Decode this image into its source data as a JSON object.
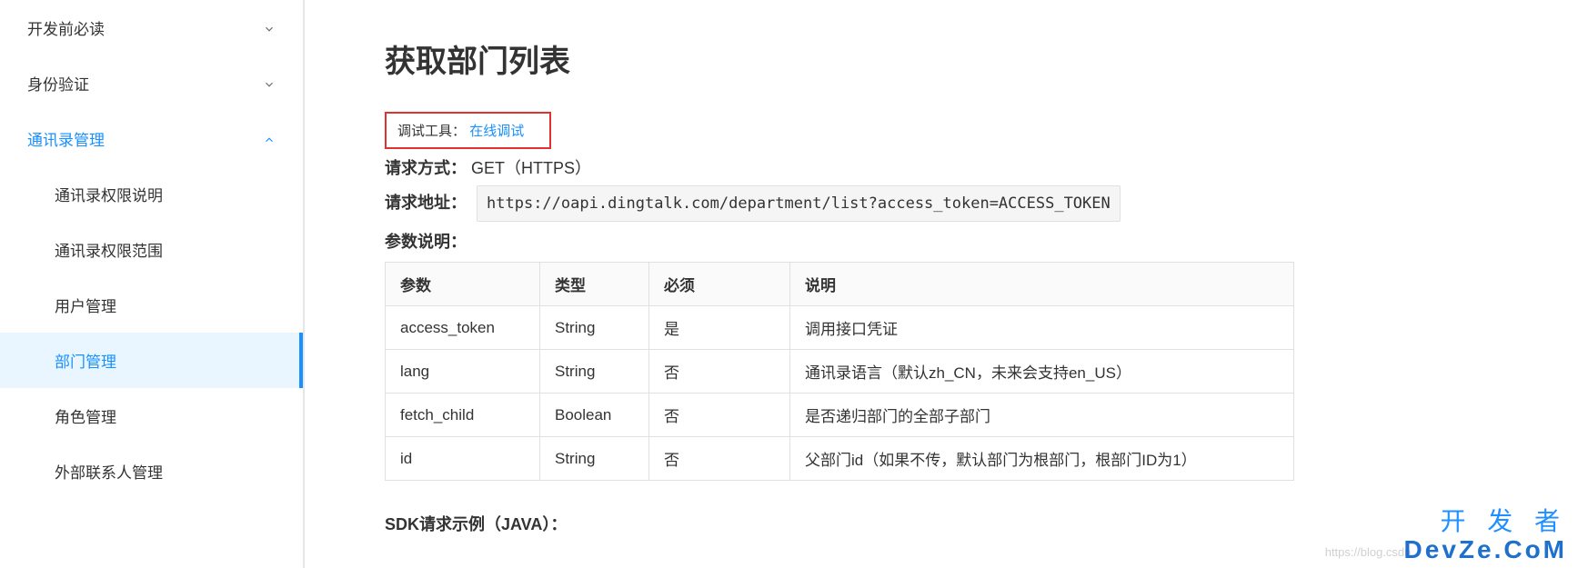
{
  "sidebar": {
    "items": [
      {
        "label": "开发前必读",
        "expanded": false
      },
      {
        "label": "身份验证",
        "expanded": false
      },
      {
        "label": "通讯录管理",
        "expanded": true,
        "children": [
          {
            "label": "通讯录权限说明"
          },
          {
            "label": "通讯录权限范围"
          },
          {
            "label": "用户管理"
          },
          {
            "label": "部门管理",
            "active": true
          },
          {
            "label": "角色管理"
          },
          {
            "label": "外部联系人管理"
          }
        ]
      }
    ]
  },
  "main": {
    "title": "获取部门列表",
    "debug": {
      "label": "调试工具：",
      "link": "在线调试"
    },
    "method": {
      "label": "请求方式：",
      "value": "GET（HTTPS）"
    },
    "url": {
      "label": "请求地址：",
      "value": "https://oapi.dingtalk.com/department/list?access_token=ACCESS_TOKEN"
    },
    "params_label": "参数说明：",
    "params_headers": {
      "param": "参数",
      "type": "类型",
      "required": "必须",
      "desc": "说明"
    },
    "params": [
      {
        "name": "access_token",
        "type": "String",
        "required": "是",
        "desc": "调用接口凭证"
      },
      {
        "name": "lang",
        "type": "String",
        "required": "否",
        "desc": "通讯录语言（默认zh_CN，未来会支持en_US）"
      },
      {
        "name": "fetch_child",
        "type": "Boolean",
        "required": "否",
        "desc": "是否递归部门的全部子部门"
      },
      {
        "name": "id",
        "type": "String",
        "required": "否",
        "desc": "父部门id（如果不传，默认部门为根部门，根部门ID为1）"
      }
    ],
    "sdk_label": "SDK请求示例（JAVA）："
  },
  "watermark": {
    "line1": "开 发 者",
    "line2": "DevZe.CoM",
    "faint": "https://blog.csdn."
  }
}
